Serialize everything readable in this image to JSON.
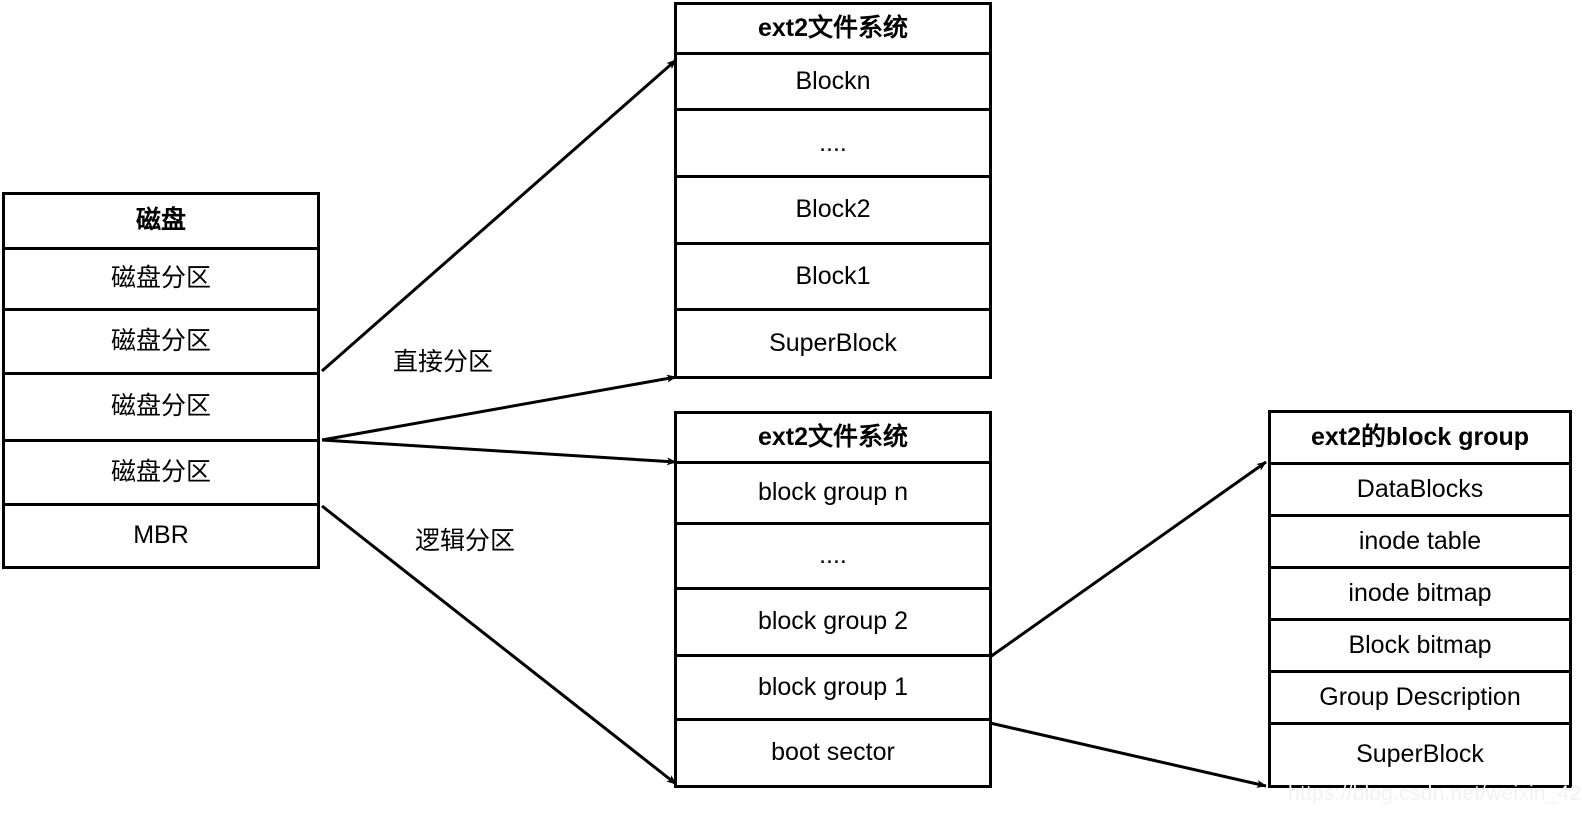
{
  "diagram": {
    "title": "ext2 filesystem layout diagram",
    "stroke_color": "#000000",
    "background_color": "#ffffff",
    "watermark": "https://blog.csdn.net/weixin_42523774"
  },
  "disk_box": {
    "header": "磁盘",
    "rows": [
      "磁盘分区",
      "磁盘分区",
      "磁盘分区",
      "磁盘分区",
      "MBR"
    ]
  },
  "ext2_blocks_box": {
    "header": "ext2文件系统",
    "rows": [
      "Blockn",
      "....",
      "Block2",
      "Block1",
      "SuperBlock"
    ]
  },
  "ext2_groups_box": {
    "header": "ext2文件系统",
    "rows": [
      "block group n",
      "....",
      "block group 2",
      "block group 1",
      "boot sector"
    ]
  },
  "block_group_box": {
    "header": "ext2的block group",
    "rows": [
      "DataBlocks",
      "inode table",
      "inode bitmap",
      "Block bitmap",
      "Group Description",
      "SuperBlock"
    ]
  },
  "connectors": {
    "direct_partition_label": "直接分区",
    "logical_partition_label": "逻辑分区"
  }
}
